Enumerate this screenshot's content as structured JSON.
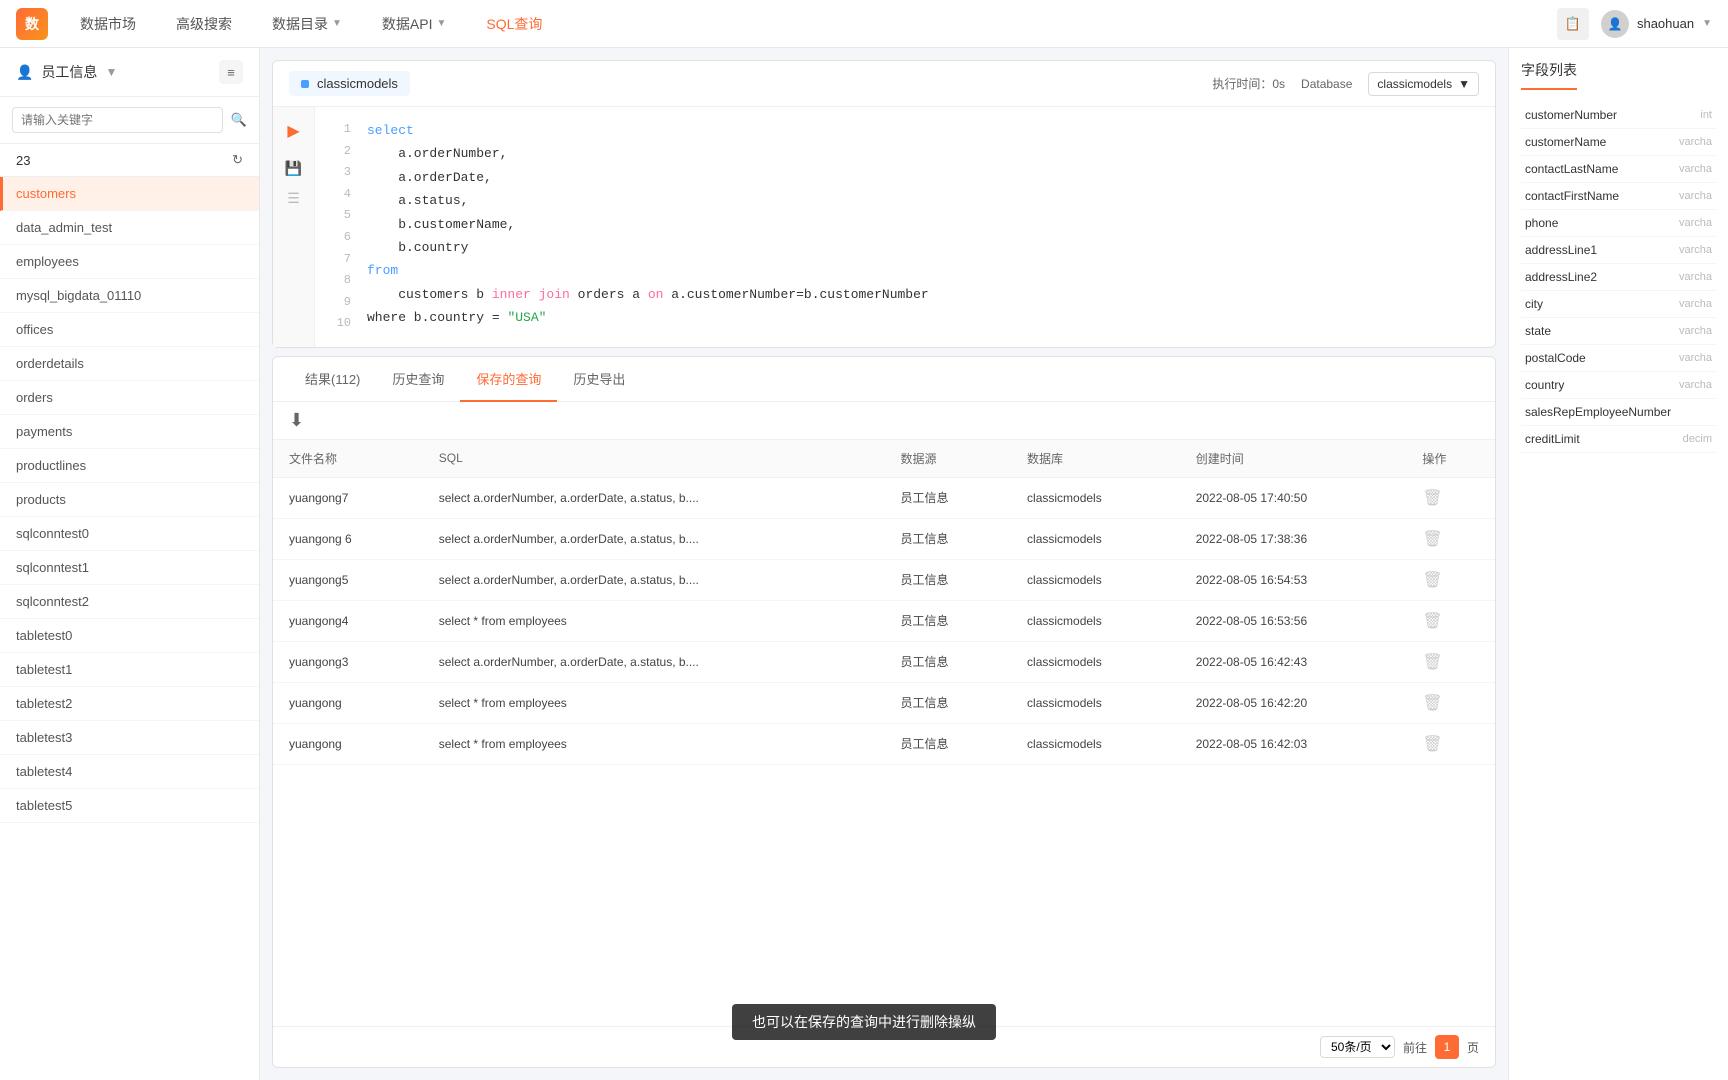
{
  "nav": {
    "logo": "数",
    "items": [
      {
        "label": "数据市场",
        "active": false
      },
      {
        "label": "高级搜索",
        "active": false
      },
      {
        "label": "数据目录",
        "active": false,
        "arrow": true
      },
      {
        "label": "数据API",
        "active": false,
        "arrow": true
      },
      {
        "label": "SQL查询",
        "active": true
      }
    ],
    "user": "shaohuan"
  },
  "sidebar": {
    "title": "员工信息",
    "search_placeholder": "请输入关键字",
    "count": "23",
    "items": [
      "customers",
      "data_admin_test",
      "employees",
      "mysql_bigdata_01110",
      "offices",
      "orderdetails",
      "orders",
      "payments",
      "productlines",
      "products",
      "sqlconntest0",
      "sqlconntest1",
      "sqlconntest2",
      "tabletest0",
      "tabletest1",
      "tabletest2",
      "tabletest3",
      "tabletest4",
      "tabletest5"
    ],
    "active_item": "customers"
  },
  "query": {
    "tab_name": "classicmodels",
    "exec_time_label": "执行时间：0s",
    "database_label": "Database",
    "database_value": "classicmodels",
    "code_lines": [
      {
        "num": 1,
        "text": "select"
      },
      {
        "num": 2,
        "text": "    a.orderNumber,"
      },
      {
        "num": 3,
        "text": "    a.orderDate,"
      },
      {
        "num": 4,
        "text": "    a.status,"
      },
      {
        "num": 5,
        "text": "    b.customerName,"
      },
      {
        "num": 6,
        "text": "    b.country"
      },
      {
        "num": 7,
        "text": "from"
      },
      {
        "num": 8,
        "text": "    customers b inner join orders a on a.customerNumber=b.customerNumber"
      },
      {
        "num": 9,
        "text": ""
      },
      {
        "num": 10,
        "text": "where b.country = \"USA\""
      }
    ]
  },
  "results": {
    "tabs": [
      {
        "label": "结果(112)",
        "active": false
      },
      {
        "label": "历史查询",
        "active": false
      },
      {
        "label": "保存的查询",
        "active": true
      },
      {
        "label": "历史导出",
        "active": false
      }
    ],
    "columns": [
      "文件名称",
      "SQL",
      "数据源",
      "数据库",
      "创建时间",
      "操作"
    ],
    "rows": [
      {
        "name": "yuangong7",
        "sql": "select a.orderNumber, a.orderDate, a.status, b....",
        "datasource": "员工信息",
        "database": "classicmodels",
        "created": "2022-08-05 17:40:50"
      },
      {
        "name": "yuangong 6",
        "sql": "select a.orderNumber, a.orderDate, a.status, b....",
        "datasource": "员工信息",
        "database": "classicmodels",
        "created": "2022-08-05 17:38:36"
      },
      {
        "name": "yuangong5",
        "sql": "select a.orderNumber, a.orderDate, a.status, b....",
        "datasource": "员工信息",
        "database": "classicmodels",
        "created": "2022-08-05 16:54:53"
      },
      {
        "name": "yuangong4",
        "sql": "select * from employees",
        "datasource": "员工信息",
        "database": "classicmodels",
        "created": "2022-08-05 16:53:56"
      },
      {
        "name": "yuangong3",
        "sql": "select a.orderNumber, a.orderDate, a.status, b....",
        "datasource": "员工信息",
        "database": "classicmodels",
        "created": "2022-08-05 16:42:43"
      },
      {
        "name": "yuangong",
        "sql": "select * from employees",
        "datasource": "员工信息",
        "database": "classicmodels",
        "created": "2022-08-05 16:42:20"
      },
      {
        "name": "yuangong",
        "sql": "select * from employees",
        "datasource": "员工信息",
        "database": "classicmodels",
        "created": "2022-08-05 16:42:03"
      }
    ],
    "page_size": "50条/页",
    "prev_label": "前往",
    "page_num": "1",
    "page_label": "页"
  },
  "tooltip": "也可以在保存的查询中进行删除操纵",
  "fields": {
    "title": "字段列表",
    "items": [
      {
        "name": "customerNumber",
        "type": "int"
      },
      {
        "name": "customerName",
        "type": "varcha"
      },
      {
        "name": "contactLastName",
        "type": "varcha"
      },
      {
        "name": "contactFirstName",
        "type": "varcha"
      },
      {
        "name": "phone",
        "type": "varcha"
      },
      {
        "name": "addressLine1",
        "type": "varcha"
      },
      {
        "name": "addressLine2",
        "type": "varcha"
      },
      {
        "name": "city",
        "type": "varcha"
      },
      {
        "name": "state",
        "type": "varcha"
      },
      {
        "name": "postalCode",
        "type": "varcha"
      },
      {
        "name": "country",
        "type": "varcha"
      },
      {
        "name": "salesRepEmployeeNumber",
        "type": ""
      },
      {
        "name": "creditLimit",
        "type": "decim"
      }
    ]
  }
}
